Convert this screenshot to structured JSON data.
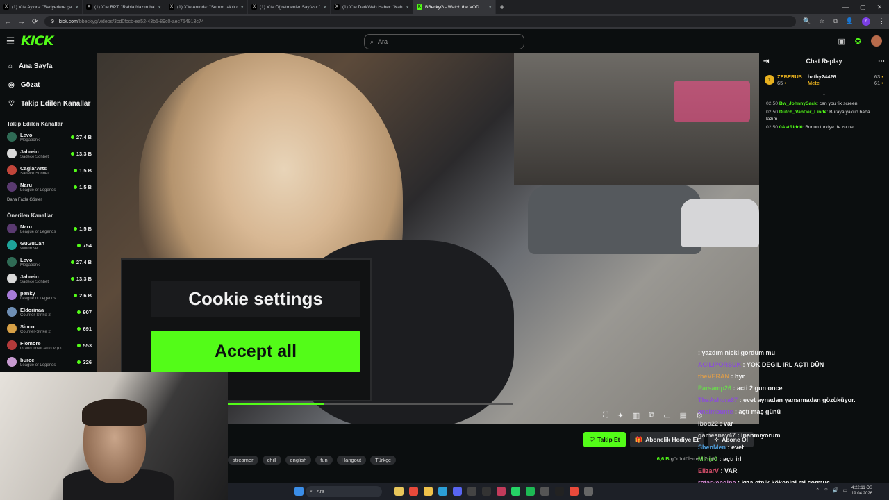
{
  "browser": {
    "tabs": [
      {
        "label": "(1) X'te Aylors: \"Bariyerlere çarp",
        "icon": "x-icon"
      },
      {
        "label": "(1) X'te BPT: \"Rabia Naz'ın bab",
        "icon": "x-icon"
      },
      {
        "label": "(1) X'te Anında: \"Serum takılı o",
        "icon": "x-icon"
      },
      {
        "label": "(1) X'te Öğretmenler Sayfası: \"",
        "icon": "x-icon"
      },
      {
        "label": "(1) X'te DarkWeb Haber: \"Kahra",
        "icon": "x-icon"
      },
      {
        "label": "BBeckyG - Watch the VOD",
        "icon": "kick-icon",
        "active": true
      }
    ],
    "url_domain": "kick.com",
    "url_path": "/bbeckyg/videos/3cd0fccb-ea52-43b5-89c0-aec754913c74",
    "profile_initial": "c"
  },
  "header": {
    "logo": "KICK",
    "search_placeholder": "Ara"
  },
  "sidebar": {
    "nav": [
      {
        "label": "Ana Sayfa",
        "icon": "home-icon"
      },
      {
        "label": "Gözat",
        "icon": "compass-icon"
      },
      {
        "label": "Takip Edilen Kanallar",
        "icon": "heart-icon"
      }
    ],
    "followed_title": "Takip Edilen Kanallar",
    "followed": [
      {
        "name": "Levo",
        "category": "Megabonk",
        "viewers": "27,4 B",
        "color": "#2f6b55"
      },
      {
        "name": "Jahrein",
        "category": "Sadece Sohbet",
        "viewers": "13,3 B",
        "color": "#d9d9d9"
      },
      {
        "name": "CaglarArts",
        "category": "Sadece Sohbet",
        "viewers": "1,5 B",
        "color": "#c1453a"
      },
      {
        "name": "Naru",
        "category": "League of Legends",
        "viewers": "1,5 B",
        "color": "#5a3a70"
      }
    ],
    "show_more": "Daha Fazla Göster",
    "recommended_title": "Önerilen Kanallar",
    "recommended": [
      {
        "name": "Naru",
        "category": "League of Legends",
        "viewers": "1,5 B",
        "color": "#5a3a70"
      },
      {
        "name": "GuGuCan",
        "category": "Windrose",
        "viewers": "754",
        "color": "#1ea39a"
      },
      {
        "name": "Levo",
        "category": "Megabonk",
        "viewers": "27,4 B",
        "color": "#2f6b55"
      },
      {
        "name": "Jahrein",
        "category": "Sadece Sohbet",
        "viewers": "13,3 B",
        "color": "#d9d9d9"
      },
      {
        "name": "panky",
        "category": "League of Legends",
        "viewers": "2,6 B",
        "color": "#a77bd8"
      },
      {
        "name": "Eldorinaa",
        "category": "Counter-Strike 2",
        "viewers": "907",
        "color": "#6e8fb5"
      },
      {
        "name": "Sinco",
        "category": "Counter-Strike 2",
        "viewers": "691",
        "color": "#d6a046"
      },
      {
        "name": "Flomore",
        "category": "Grand Theft Auto V (G...",
        "viewers": "553",
        "color": "#b33a3a"
      },
      {
        "name": "burce",
        "category": "League of Legends",
        "viewers": "326",
        "color": "#c89bd1"
      }
    ]
  },
  "player": {
    "cookie_title": "Cookie settings",
    "cookie_accept": "Accept all",
    "progress_fraction": 0.34,
    "controls": [
      "crop-icon",
      "sparkle-icon",
      "layout-icon",
      "pip-icon",
      "theater-icon",
      "subtitle-icon",
      "settings-icon"
    ]
  },
  "chat": {
    "title": "Chat Replay",
    "gifters": [
      {
        "name": "ZEBERUS",
        "count": "65",
        "rank": "1"
      },
      {
        "name": "hathy24426",
        "count": "63"
      },
      {
        "name": "Mete",
        "count": "61"
      }
    ],
    "messages": [
      {
        "time": "02:50",
        "user": "Bw_JohnnySack",
        "text": "can you fix screen"
      },
      {
        "time": "02:50",
        "user": "Dutch_VanDer_Linde",
        "text": "Buraya yakup baba lazım"
      },
      {
        "time": "02:50",
        "user": "0AstRidd0",
        "text": "Bunun turkiye de ısı ne"
      }
    ]
  },
  "below_video": {
    "follow": "Takip Et",
    "gift": "Abonelik Hediye Et",
    "subscribe": "Abone Ol",
    "tags": [
      "streamer",
      "chill",
      "english",
      "fun",
      "Hangout",
      "Türkçe"
    ],
    "views": "6,6 B",
    "views_label": "görüntüleme",
    "ago": "2 gün"
  },
  "stream_overlay_chat": [
    {
      "user": "",
      "text": "yazdım nicki gordum mu",
      "color": "#5b5bd6"
    },
    {
      "user": "ACILIPORSUK",
      "text": "YOK DEGIL IRL AÇTI DÜN",
      "color": "#8b4fd6"
    },
    {
      "user": "theVERAN",
      "text": "hyr",
      "color": "#d69b4f"
    },
    {
      "user": "Parsamp26",
      "text": "acti 2 gun once",
      "color": "#6bd64f"
    },
    {
      "user": "TheAshura67",
      "text": "evet aynadan yansımadan gözüküyor.",
      "color": "#8b4fd6"
    },
    {
      "user": "anaimbunte",
      "text": "açtı maç günü",
      "color": "#8b4fd6"
    },
    {
      "user": "iboo22",
      "text": "var",
      "color": "#c8c8c8"
    },
    {
      "user": "gamesnav47",
      "text": "inanmıyorum",
      "color": "#c8c8c8"
    },
    {
      "user": "ShenMen",
      "text": "evet",
      "color": "#4f9bd6"
    },
    {
      "user": "Minic0",
      "text": "açtı irl",
      "color": "#6bd64f"
    },
    {
      "user": "ElizarV",
      "text": "VAR",
      "color": "#d64f6b"
    },
    {
      "user": "rotaryengine",
      "text": "kıza etnik kökenini mi sormuş",
      "color": "#d68bd6"
    }
  ],
  "taskbar": {
    "search": "Ara",
    "time": "4:22:11 ÖS",
    "date": "19.04.2026"
  }
}
